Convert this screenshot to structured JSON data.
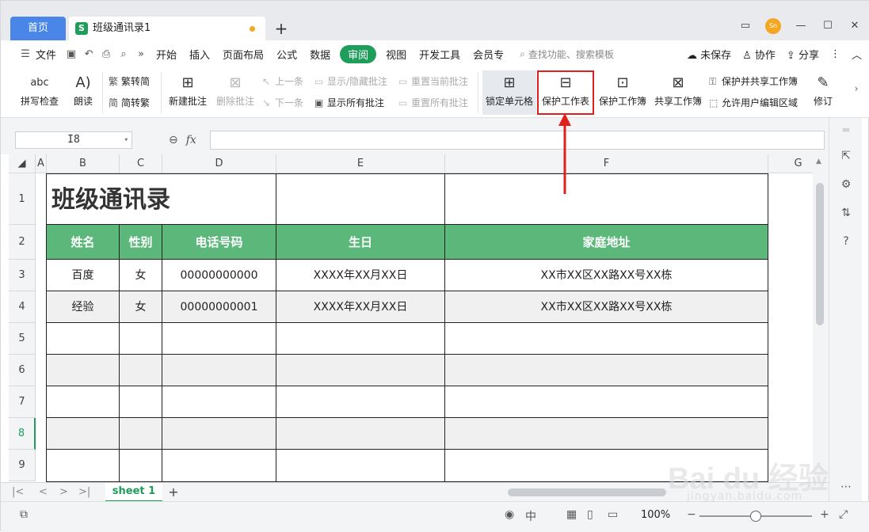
{
  "titlebar": {
    "home_tab": "首页",
    "file_tab_logo": "S",
    "file_tab_name": "班级通讯录1",
    "new_tab": "+",
    "avatar_text": "Sn",
    "window_buttons": [
      "—",
      "☐",
      "✕"
    ]
  },
  "menubar": {
    "file_label": "文件",
    "items": [
      "开始",
      "插入",
      "页面布局",
      "公式",
      "数据",
      "审阅",
      "视图",
      "开发工具",
      "会员专"
    ],
    "active_item": "审阅",
    "search_placeholder": "查找功能、搜索模板",
    "unsaved": "未保存",
    "collab": "协作",
    "share": "分享"
  },
  "ribbon": {
    "spell_check": "拼写检查",
    "read_aloud": "朗读",
    "trad_to_simp": "繁转简",
    "simp_to_trad": "简转繁",
    "new_comment": "新建批注",
    "delete_comment": "删除批注",
    "prev": "上一条",
    "next": "下一条",
    "show_hide_comment": "显示/隐藏批注",
    "show_all_comments": "显示所有批注",
    "reset_current": "重置当前批注",
    "reset_all": "重置所有批注",
    "lock_cells": "锁定单元格",
    "protect_sheet": "保护工作表",
    "protect_workbook": "保护工作簿",
    "share_workbook": "共享工作簿",
    "protect_share_workbook": "保护并共享工作簿",
    "allow_edit_range": "允许用户编辑区域",
    "revise": "修订"
  },
  "formula_bar": {
    "cell_ref": "I8",
    "fx": "fx",
    "value": ""
  },
  "grid": {
    "columns": [
      "A",
      "B",
      "C",
      "D",
      "E",
      "F",
      "G"
    ],
    "rows": [
      "1",
      "2",
      "3",
      "4",
      "5",
      "6",
      "7",
      "8",
      "9"
    ],
    "title": "班级通讯录",
    "headers": [
      "姓名",
      "性别",
      "电话号码",
      "生日",
      "家庭地址"
    ],
    "data": [
      [
        "百度",
        "女",
        "00000000000",
        "XXXX年XX月XX日",
        "XX市XX区XX路XX号XX栋"
      ],
      [
        "经验",
        "女",
        "00000000001",
        "XXXX年XX月XX日",
        "XX市XX区XX路XX号XX栋"
      ]
    ],
    "header_color": "#5bb87a"
  },
  "sheetbar": {
    "sheet_name": "sheet 1",
    "add": "+"
  },
  "statusbar": {
    "zoom": "100%",
    "zoom_fraction": 0.5
  },
  "watermark": {
    "brand": "Bai du 经验",
    "url": "jingyan.baidu.com"
  },
  "colors": {
    "accent": "#1e9e5a",
    "highlight_box": "#e0201b",
    "home_tab": "#4a86e8"
  }
}
